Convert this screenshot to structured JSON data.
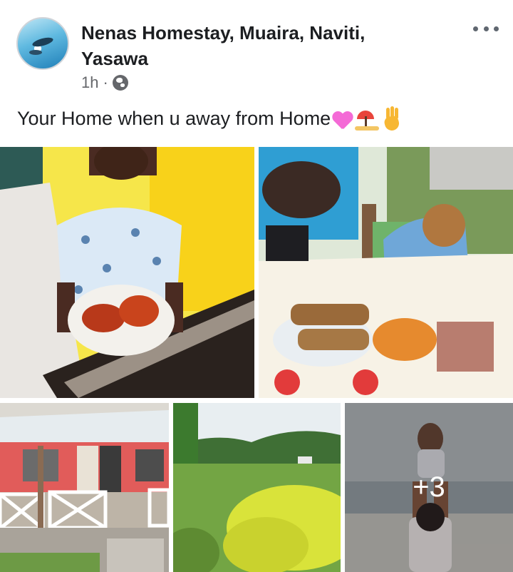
{
  "post": {
    "page_name": "Nenas Homestay, Muaira, Naviti, Yasawa",
    "time_ago": "1h",
    "separator": "·",
    "audience_icon": "globe-icon",
    "more_icon": "more-options-icon",
    "caption": "Your Home when u away from Home",
    "caption_emojis": [
      "pink-heart-emoji",
      "beach-umbrella-emoji",
      "waving-hand-emoji"
    ]
  },
  "gallery": {
    "photos": [
      {
        "name": "photo-boy-with-lobster"
      },
      {
        "name": "photo-dining-table"
      },
      {
        "name": "photo-homestay-building"
      },
      {
        "name": "photo-green-field-hills"
      },
      {
        "name": "photo-baby-on-beach"
      }
    ],
    "more_count_label": "+3"
  },
  "colors": {
    "text_primary": "#1c1e21",
    "text_secondary": "#65676b",
    "background": "#ffffff"
  }
}
